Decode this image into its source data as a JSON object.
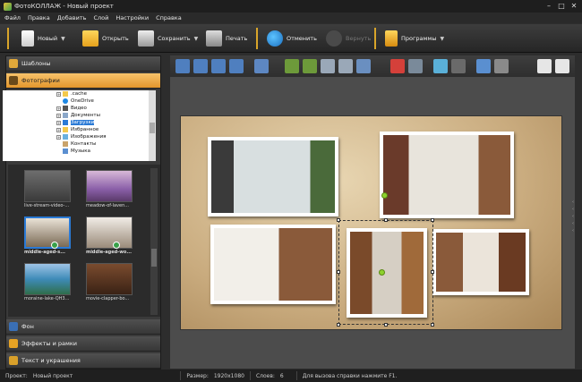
{
  "window": {
    "title": "ФотоКОЛЛАЖ - Новый проект"
  },
  "menu": [
    "Файл",
    "Правка",
    "Добавить",
    "Слой",
    "Настройки",
    "Справка"
  ],
  "toolbar": {
    "new": "Новый",
    "open": "Открыть",
    "save": "Сохранить",
    "print": "Печать",
    "undo": "Отменить",
    "redo": "Вернуть",
    "programs": "Программы"
  },
  "sidebar": {
    "templates": "Шаблоны",
    "photos": "Фотографии",
    "background": "Фон",
    "effects": "Эффекты и рамки",
    "text": "Текст и украшения"
  },
  "tree": [
    {
      "label": ".cache",
      "icon": "folder-icon"
    },
    {
      "label": "OneDrive",
      "icon": "cloud-icon"
    },
    {
      "label": "Видео",
      "icon": "video-folder-icon"
    },
    {
      "label": "Документы",
      "icon": "documents-folder-icon"
    },
    {
      "label": "Загрузки",
      "icon": "downloads-folder-icon"
    },
    {
      "label": "Избранное",
      "icon": "star-folder-icon"
    },
    {
      "label": "Изображения",
      "icon": "images-folder-icon"
    },
    {
      "label": "Контакты",
      "icon": "contacts-folder-icon"
    },
    {
      "label": "Музыка",
      "icon": "music-folder-icon"
    }
  ],
  "thumbnails": [
    {
      "caption": "live-stream-video-...",
      "selected": false,
      "checked": false
    },
    {
      "caption": "meadow-of-laven...",
      "selected": false,
      "checked": false
    },
    {
      "caption": "middle-aged-s...",
      "selected": true,
      "checked": true
    },
    {
      "caption": "middle-aged-wo...",
      "selected": false,
      "checked": true
    },
    {
      "caption": "moraine-lake-QH3...",
      "selected": false,
      "checked": false
    },
    {
      "caption": "movie-clapper-bo...",
      "selected": false,
      "checked": false
    }
  ],
  "status": {
    "project_label": "Проект:",
    "project_value": "Новый проект",
    "size_label": "Размер:",
    "size_value": "1920x1080",
    "layers_label": "Слоев:",
    "layers_value": "6",
    "hint": "Для вызова справки нажмите F1."
  },
  "colors": {
    "accent": "#e3962c",
    "selection": "#2a7ad6",
    "check": "#3aa14a"
  }
}
